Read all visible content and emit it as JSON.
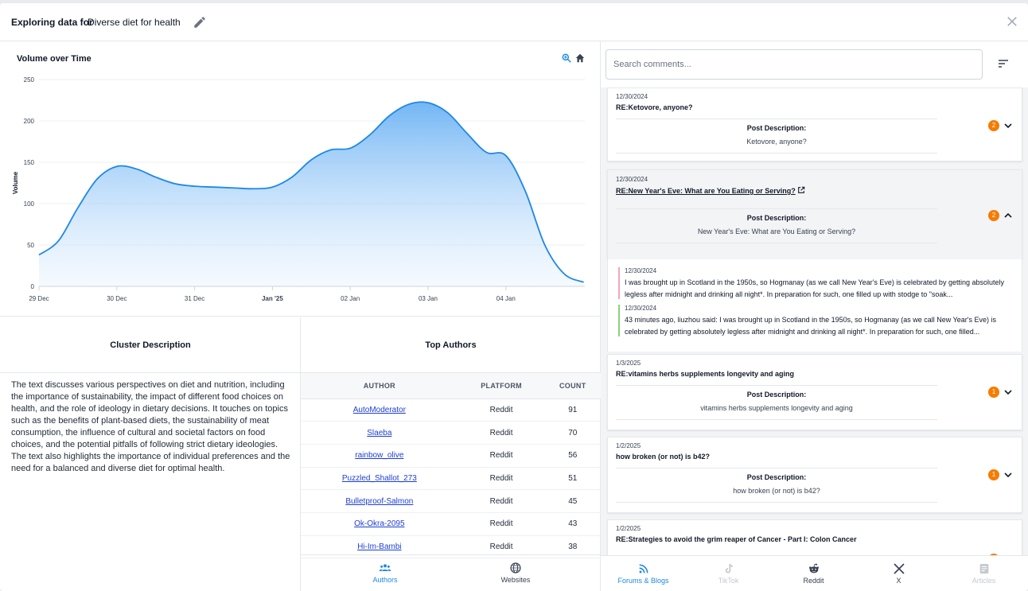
{
  "header": {
    "label": "Exploring data for",
    "topic": "Diverse diet for health"
  },
  "chart": {
    "title": "Volume over Time"
  },
  "chart_data": {
    "type": "area",
    "title": "Volume over Time",
    "xlabel": "",
    "ylabel": "Volume",
    "ylim": [
      0,
      250
    ],
    "yticks": [
      0,
      50,
      100,
      150,
      200,
      250
    ],
    "xticks": [
      "29 Dec",
      "30 Dec",
      "31 Dec",
      "Jan '25",
      "02 Jan",
      "03 Jan",
      "04 Jan"
    ],
    "bold_xtick": "Jan '25",
    "x": [
      0,
      0.25,
      0.5,
      0.75,
      1,
      1.25,
      1.5,
      1.75,
      2,
      2.25,
      2.5,
      2.75,
      3,
      3.25,
      3.5,
      3.75,
      4,
      4.25,
      4.5,
      4.75,
      5,
      5.25,
      5.5,
      5.75,
      6,
      6.25,
      6.5,
      6.75,
      7
    ],
    "values": [
      38,
      55,
      95,
      130,
      145,
      142,
      132,
      124,
      121,
      120,
      119,
      118,
      120,
      132,
      153,
      165,
      167,
      183,
      206,
      220,
      222,
      210,
      185,
      162,
      158,
      115,
      50,
      15,
      5
    ],
    "color": "#1e88e5",
    "grid": true
  },
  "cluster": {
    "title": "Cluster Description",
    "text": "The text discusses various perspectives on diet and nutrition, including the importance of sustainability, the impact of different food choices on health, and the role of ideology in dietary decisions. It touches on topics such as the benefits of plant-based diets, the sustainability of meat consumption, the influence of cultural and societal factors on food choices, and the potential pitfalls of following strict dietary ideologies. The text also highlights the importance of individual preferences and the need for a balanced and diverse diet for optimal health."
  },
  "authors": {
    "title": "Top Authors",
    "columns": [
      "AUTHOR",
      "PLATFORM",
      "COUNT"
    ],
    "rows": [
      {
        "author": "AutoModerator",
        "platform": "Reddit",
        "count": "91"
      },
      {
        "author": "Slaeba",
        "platform": "Reddit",
        "count": "70"
      },
      {
        "author": "rainbow_olive",
        "platform": "Reddit",
        "count": "56"
      },
      {
        "author": "Puzzled_Shallot_273",
        "platform": "Reddit",
        "count": "51"
      },
      {
        "author": "Bulletproof-Salmon",
        "platform": "Reddit",
        "count": "45"
      },
      {
        "author": "Ok-Okra-2095",
        "platform": "Reddit",
        "count": "43"
      },
      {
        "author": "Hi-Im-Bambi",
        "platform": "Reddit",
        "count": "38"
      }
    ]
  },
  "left_tabs": [
    {
      "label": "Authors",
      "icon": "people-icon",
      "active": true
    },
    {
      "label": "Websites",
      "icon": "globe-icon",
      "active": false
    }
  ],
  "search": {
    "placeholder": "Search comments..."
  },
  "posts": [
    {
      "date": "12/30/2024",
      "title": "RE:Ketovore, anyone?",
      "desc_label": "Post Description:",
      "desc": "Ketovore, anyone?",
      "count": "2",
      "expanded": false
    },
    {
      "date": "12/30/2024",
      "title": "RE:New Year's Eve: What are You Eating or Serving?",
      "desc_label": "Post Description:",
      "desc": "New Year's Eve: What are You Eating or Serving?",
      "count": "2",
      "expanded": true
    },
    {
      "date": "1/3/2025",
      "title": "RE:vitamins herbs supplements longevity and aging",
      "desc_label": "Post Description:",
      "desc": "vitamins herbs supplements longevity and aging",
      "count": "1",
      "expanded": false
    },
    {
      "date": "1/2/2025",
      "title": "how broken (or not) is b42?",
      "desc_label": "Post Description:",
      "desc": "how broken (or not) is b42?",
      "count": "1",
      "expanded": false
    },
    {
      "date": "1/2/2025",
      "title": "RE:Strategies to avoid the grim reaper of Cancer - Part I: Colon Cancer",
      "desc_label": "",
      "desc": "",
      "count": "",
      "expanded": false
    }
  ],
  "replies": [
    {
      "date": "12/30/2024",
      "text": "I was brought up in Scotland in the 1950s, so Hogmanay (as we call New Year's Eve) is celebrated by getting absolutely legless after midnight and drinking all night*. In preparation for such, one filled up with stodge to \"soak...",
      "bar_color": "#f4a6b8"
    },
    {
      "date": "12/30/2024",
      "text": "43 minutes ago, liuzhou said: I was brought up in Scotland in the 1950s, so Hogmanay (as we call New Year's Eve) is celebrated by getting absolutely legless after midnight and drinking all night*. In preparation for such, one filled...",
      "bar_color": "#8bd17c"
    }
  ],
  "right_tabs": [
    {
      "label": "Forums & Blogs",
      "icon": "rss-icon",
      "state": "active"
    },
    {
      "label": "TikTok",
      "icon": "tiktok-icon",
      "state": "disabled"
    },
    {
      "label": "Reddit",
      "icon": "reddit-icon",
      "state": "normal"
    },
    {
      "label": "X",
      "icon": "x-icon",
      "state": "normal"
    },
    {
      "label": "Articles",
      "icon": "article-icon",
      "state": "disabled"
    }
  ],
  "colors": {
    "accent": "#1e88e5",
    "badge": "#f57c00",
    "link": "#1d3fd1",
    "disabled": "#c4c8cd"
  }
}
